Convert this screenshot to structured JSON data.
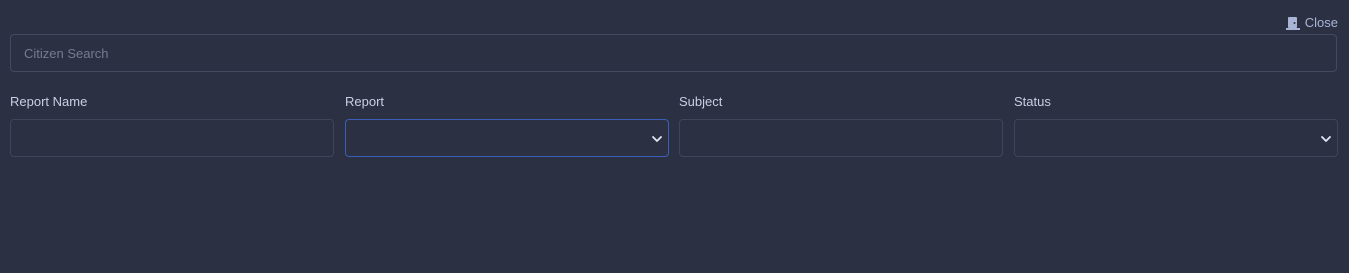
{
  "header": {
    "close_label": "Close",
    "close_icon": "door-icon"
  },
  "search": {
    "placeholder": "Citizen Search",
    "value": ""
  },
  "fields": {
    "report_name": {
      "label": "Report Name",
      "value": ""
    },
    "report": {
      "label": "Report",
      "selected": ""
    },
    "subject": {
      "label": "Subject",
      "value": ""
    },
    "status": {
      "label": "Status",
      "selected": ""
    }
  },
  "colors": {
    "background": "#2b3043",
    "border": "#3f465a",
    "focus_border": "#3a5fb8",
    "label_text": "#c9cfe2",
    "placeholder_text": "#747c92",
    "close_link": "#a9b4d6"
  }
}
